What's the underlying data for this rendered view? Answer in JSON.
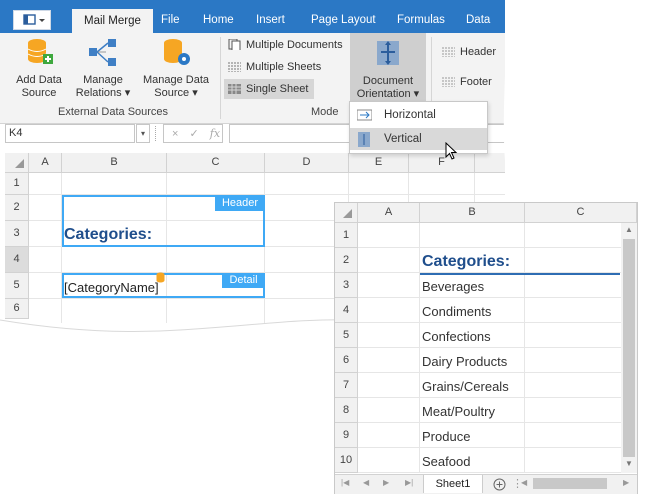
{
  "tabs": [
    {
      "label": "Mail Merge",
      "active": true
    },
    {
      "label": "File"
    },
    {
      "label": "Home"
    },
    {
      "label": "Insert"
    },
    {
      "label": "Page Layout"
    },
    {
      "label": "Formulas"
    },
    {
      "label": "Data"
    }
  ],
  "ribbon": {
    "add_data_source": "Add Data Source",
    "add_data_source_l1": "Add Data",
    "add_data_source_l2": "Source",
    "manage_relations_l1": "Manage",
    "manage_relations_l2": "Relations ▾",
    "manage_data_source_l1": "Manage Data",
    "manage_data_source_l2": "Source ▾",
    "group_external": "External Data Sources",
    "multiple_documents": "Multiple Documents",
    "multiple_sheets": "Multiple Sheets",
    "single_sheet": "Single Sheet",
    "group_mode": "Mode",
    "doc_orientation_l1": "Document",
    "doc_orientation_l2": "Orientation ▾",
    "header": "Header",
    "footer": "Footer"
  },
  "dropdown": {
    "horizontal": "Horizontal",
    "vertical": "Vertical"
  },
  "formula_bar": {
    "name_box": "K4",
    "cancel": "×",
    "enter": "✓",
    "fx": "fx"
  },
  "grid1": {
    "columns": [
      "A",
      "B",
      "C",
      "D",
      "E",
      "F"
    ],
    "rows": [
      "1",
      "2",
      "3",
      "4",
      "5",
      "6"
    ],
    "header_tag": "Header",
    "detail_tag": "Detail",
    "categories": "Categories:",
    "category_field": "[CategoryName]"
  },
  "grid2": {
    "columns": [
      "A",
      "B",
      "C"
    ],
    "rows": [
      "1",
      "2",
      "3",
      "4",
      "5",
      "6",
      "7",
      "8",
      "9",
      "10"
    ],
    "title": "Categories:",
    "items": [
      "Beverages",
      "Condiments",
      "Confections",
      "Dairy Products",
      "Grains/Cereals",
      "Meat/Poultry",
      "Produce",
      "Seafood"
    ],
    "sheet_tab": "Sheet1"
  },
  "colors": {
    "accent": "#2b78c5",
    "tag_blue": "#3fa9f5",
    "title_blue": "#1f4e8c"
  }
}
